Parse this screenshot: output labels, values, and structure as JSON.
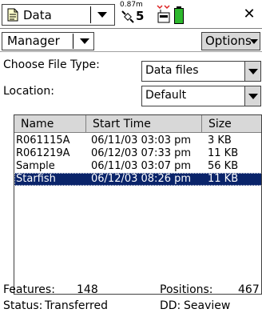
{
  "topbar": {
    "app_label": "Data",
    "gps_accuracy": "0.87m",
    "satellite_count": "5"
  },
  "sectionbar": {
    "section_label": "Manager",
    "options_label": "Options"
  },
  "form": {
    "file_type_label": "Choose File Type:",
    "file_type_value": "Data files",
    "location_label": "Location:",
    "location_value": "Default"
  },
  "files": {
    "headers": {
      "name": "Name",
      "start_time": "Start Time",
      "size": "Size"
    },
    "rows": [
      {
        "name": "R061115A",
        "start_time": "06/11/03 03:03 pm",
        "size": "3 KB"
      },
      {
        "name": "R061219A",
        "start_time": "06/12/03 07:33 pm",
        "size": "11 KB"
      },
      {
        "name": "Sample",
        "start_time": "06/11/03 03:07 pm",
        "size": "56 KB"
      },
      {
        "name": "Starfish",
        "start_time": "06/12/03 08:26 pm",
        "size": "11 KB"
      }
    ],
    "selected_index": 3
  },
  "status": {
    "features_label": "Features:",
    "features_value": "148",
    "positions_label": "Positions:",
    "positions_value": "467",
    "status_label": "Status:",
    "status_value": "Transferred",
    "dd_label": "DD:",
    "dd_value": "Seaview"
  },
  "colors": {
    "selection": "#0a246a",
    "battery": "#2eb82e",
    "receiver": "#d22"
  }
}
